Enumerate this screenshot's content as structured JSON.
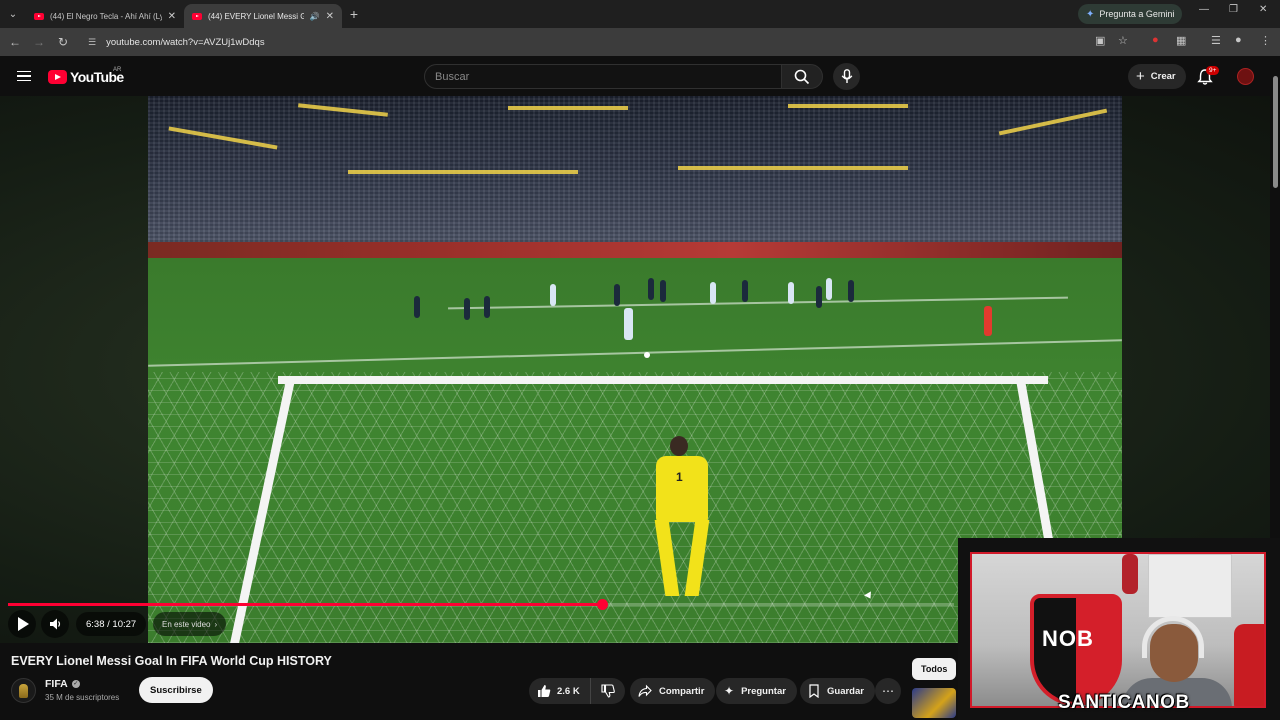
{
  "browser": {
    "tabs": [
      {
        "title": "(44) El Negro Tecla - Ahí Ahí (Ly",
        "active": false
      },
      {
        "title": "(44) EVERY Lionel Messi Go",
        "active": true
      }
    ],
    "gemini_label": "Pregunta a Gemini",
    "url": "youtube.com/watch?v=AVZUj1wDdqs"
  },
  "header": {
    "logo_text": "YouTube",
    "country_code": "AR",
    "search_placeholder": "Buscar",
    "create_label": "Crear",
    "notif_badge": "9+"
  },
  "player": {
    "progress": 0.6274,
    "time_current": "6:38",
    "time_sep": " / ",
    "time_total": "10:27",
    "chapter_label": "En este video",
    "keeper_number": "1"
  },
  "video": {
    "title": "EVERY Lionel Messi Goal In FIFA World Cup HISTORY",
    "channel_name": "FIFA",
    "subscribers": "35 M de suscriptores",
    "subscribe_label": "Suscribirse",
    "likes": "2.6 K",
    "share_label": "Compartir",
    "ask_label": "Preguntar",
    "save_label": "Guardar"
  },
  "sidebar": {
    "chip_all": "Todos"
  },
  "webcam": {
    "shield_text": "NOB",
    "streamer_name": "SANTICANOB"
  },
  "colors": {
    "accent": "#ff0033",
    "background": "#0f0f0f",
    "keeper_kit": "#f2e21a",
    "nob_red": "#d41f2a"
  }
}
